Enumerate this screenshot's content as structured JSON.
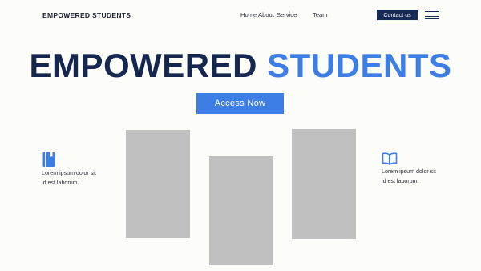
{
  "header": {
    "brand": "EMPOWERED STUDENTS",
    "nav": [
      "Home",
      "About",
      "Service",
      "Team"
    ],
    "contact_label": "Contact us",
    "menu_icon": "hamburger-menu-icon"
  },
  "hero": {
    "title_part1": "EMPOWERED",
    "title_part2": "STUDENTS",
    "cta_label": "Access Now"
  },
  "features": [
    {
      "icon": "notebook-icon",
      "line1": "Lorem ipsum dolor sit",
      "line2": "id est laborum."
    },
    {
      "icon": "open-book-icon",
      "line1": "Lorem ipsum dolor sit",
      "line2": "id est laborum."
    }
  ],
  "colors": {
    "navy": "#152a55",
    "accent_blue": "#3d7de6",
    "placeholder_gray": "#c0c0c0",
    "background": "#fcfcf9"
  }
}
